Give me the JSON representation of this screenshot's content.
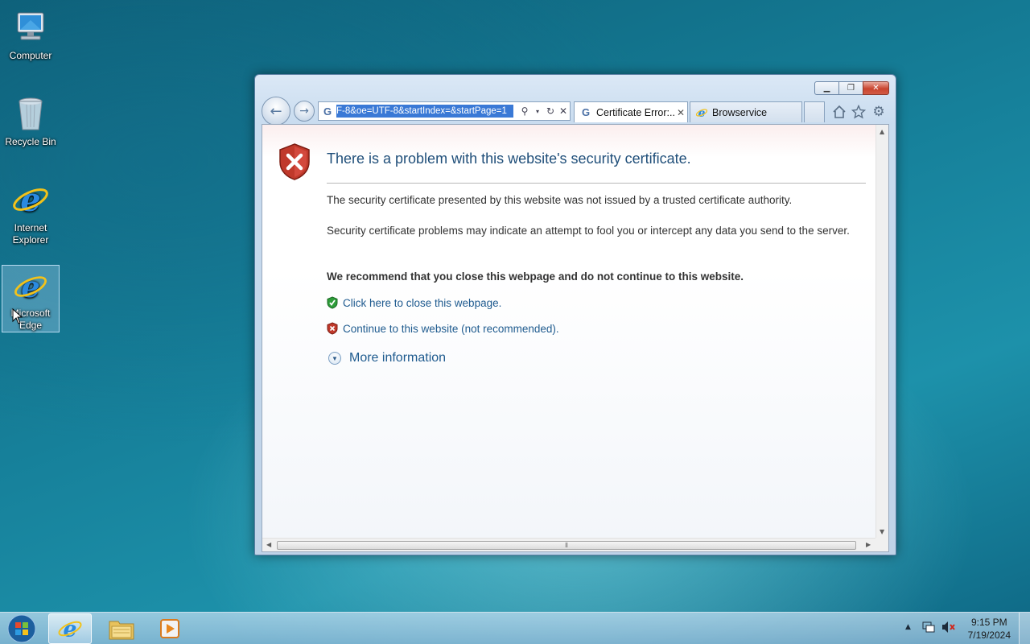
{
  "desktop": {
    "icons": [
      {
        "label": "Computer"
      },
      {
        "label": "Recycle Bin"
      },
      {
        "label": "Internet\nExplorer"
      },
      {
        "label": "Microsoft\nEdge"
      }
    ]
  },
  "browser": {
    "address_url": "F-8&oe=UTF-8&startIndex=&startPage=1",
    "tabs": [
      {
        "title": "Certificate Error:...",
        "active": true
      },
      {
        "title": "Browservice",
        "active": false
      }
    ]
  },
  "page": {
    "title": "There is a problem with this website's security certificate.",
    "para1": "The security certificate presented by this website was not issued by a trusted certificate authority.",
    "para2": "Security certificate problems may indicate an attempt to fool you or intercept any data you send to the server.",
    "recommend": "We recommend that you close this webpage and do not continue to this website.",
    "close_link": "Click here to close this webpage.",
    "continue_link": "Continue to this website (not recommended).",
    "more_info": "More information"
  },
  "taskbar": {
    "time": "9:15 PM",
    "date": "7/19/2024"
  },
  "colors": {
    "link": "#1f5b8f",
    "title": "#1f4e79",
    "shield_red": "#c0392b",
    "shield_green": "#2e9d3a",
    "address_highlight": "#3a79d6"
  }
}
